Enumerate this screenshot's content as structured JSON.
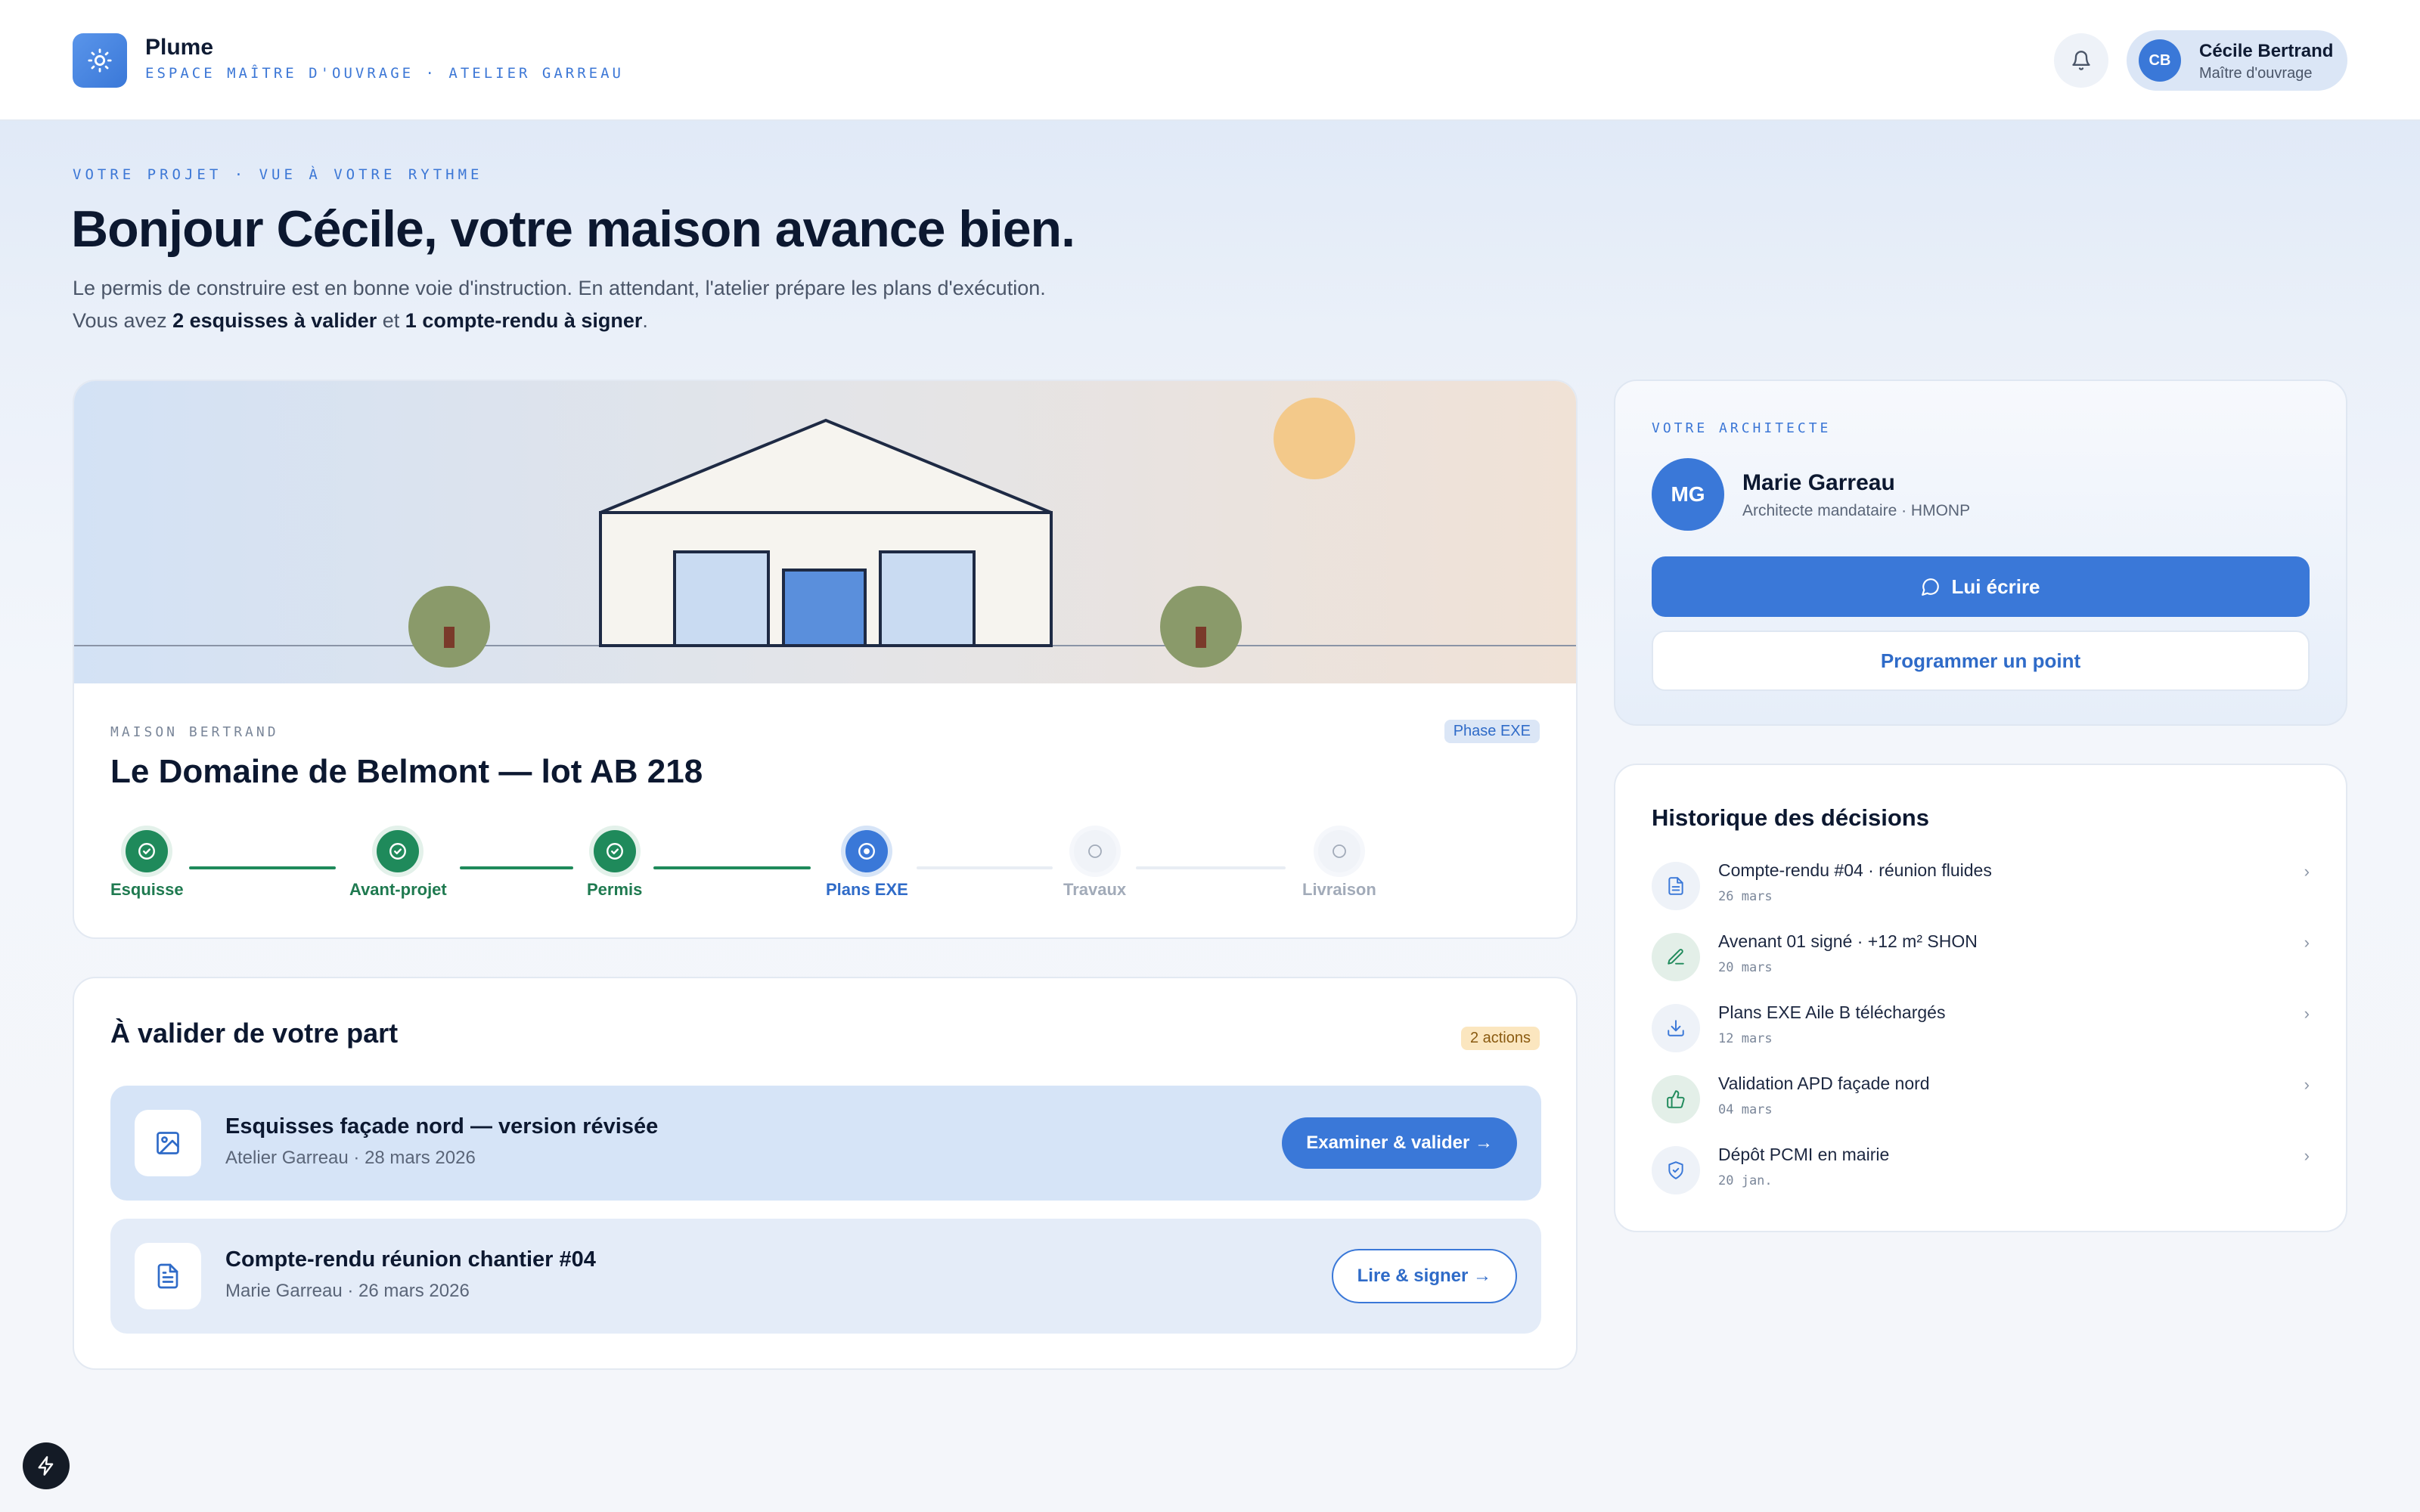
{
  "header": {
    "app_name": "Plume",
    "app_subtitle": "ESPACE MAÎTRE D'OUVRAGE · ATELIER GARREAU",
    "user": {
      "initials": "CB",
      "name": "Cécile Bertrand",
      "role": "Maître d'ouvrage"
    }
  },
  "hero": {
    "eyebrow": "VOTRE PROJET · VUE À VOTRE RYTHME",
    "title": "Bonjour Cécile, votre maison avance bien.",
    "text_1": "Le permis de construire est en bonne voie d'instruction. En attendant, l'atelier prépare les plans d'exécution. Vous avez ",
    "text_strong_1": "2 esquisses à valider",
    "text_2": " et ",
    "text_strong_2": "1 compte-rendu à signer",
    "text_3": "."
  },
  "project": {
    "eyebrow": "MAISON BERTRAND",
    "phase_badge": "Phase EXE",
    "title": "Le Domaine de Belmont — lot AB 218",
    "steps": [
      {
        "label": "Esquisse",
        "status": "done"
      },
      {
        "label": "Avant-projet",
        "status": "done"
      },
      {
        "label": "Permis",
        "status": "done"
      },
      {
        "label": "Plans EXE",
        "status": "current"
      },
      {
        "label": "Travaux",
        "status": "todo"
      },
      {
        "label": "Livraison",
        "status": "todo"
      }
    ]
  },
  "validation": {
    "title": "À valider de votre part",
    "badge": "2 actions",
    "tasks": [
      {
        "title": "Esquisses façade nord — version révisée",
        "meta": "Atelier Garreau · 28 mars 2026",
        "action": "Examiner & valider →",
        "icon": "image-icon"
      },
      {
        "title": "Compte-rendu réunion chantier #04",
        "meta": "Marie Garreau · 26 mars 2026",
        "action": "Lire & signer →",
        "icon": "document-icon"
      }
    ]
  },
  "architect": {
    "eyebrow": "VOTRE ARCHITECTE",
    "initials": "MG",
    "name": "Marie Garreau",
    "role": "Architecte mandataire · HMONP",
    "write_button": "Lui écrire",
    "schedule_button": "Programmer un point"
  },
  "history": {
    "title": "Historique des décisions",
    "items": [
      {
        "label": "Compte-rendu #04 · réunion fluides",
        "date": "26 mars",
        "icon": "document-icon"
      },
      {
        "label": "Avenant 01 signé · +12 m² SHON",
        "date": "20 mars",
        "icon": "pen-icon"
      },
      {
        "label": "Plans EXE Aile B téléchargés",
        "date": "12 mars",
        "icon": "download-icon"
      },
      {
        "label": "Validation APD façade nord",
        "date": "04 mars",
        "icon": "thumbs-up-icon"
      },
      {
        "label": "Dépôt PCMI en mairie",
        "date": "20 jan.",
        "icon": "shield-icon"
      }
    ]
  },
  "colors": {
    "accent": "#3a78d8",
    "success": "#1f8a5b",
    "warning_bg": "#fbe6bf"
  }
}
